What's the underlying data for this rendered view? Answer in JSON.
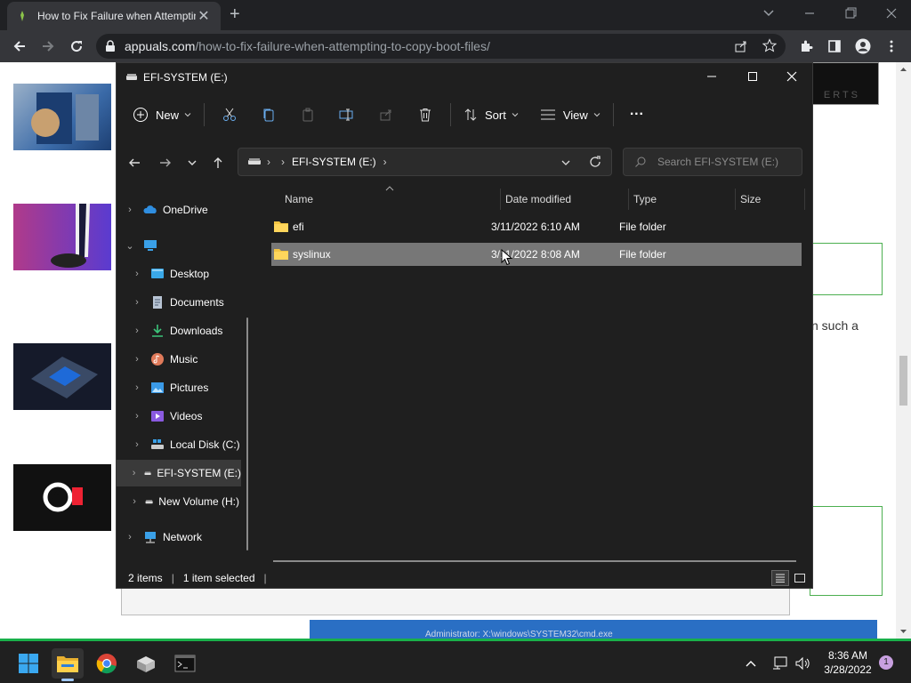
{
  "browser": {
    "tab_title": "How to Fix Failure when Attempting",
    "tab_close": "✕",
    "new_tab": "+",
    "url_domain": "appuals.com",
    "url_path": "/how-to-fix-failure-when-attempting-to-copy-boot-files/"
  },
  "page": {
    "partial_text": "n such a",
    "watermark": "ERTS",
    "bottom_window_title": "Administrator: X:\\windows\\SYSTEM32\\cmd.exe"
  },
  "explorer": {
    "title": "EFI-SYSTEM (E:)",
    "toolbar": {
      "new_label": "New",
      "sort_label": "Sort",
      "view_label": "View",
      "more": "···"
    },
    "address": {
      "location": "EFI-SYSTEM (E:)",
      "search_placeholder": "Search EFI-SYSTEM (E:)"
    },
    "nav": [
      {
        "label": "OneDrive"
      },
      {
        "label": ""
      },
      {
        "label": "Desktop"
      },
      {
        "label": "Documents"
      },
      {
        "label": "Downloads"
      },
      {
        "label": "Music"
      },
      {
        "label": "Pictures"
      },
      {
        "label": "Videos"
      },
      {
        "label": "Local Disk (C:)"
      },
      {
        "label": "EFI-SYSTEM (E:)"
      },
      {
        "label": "New Volume (H:)"
      },
      {
        "label": "Network"
      }
    ],
    "columns": {
      "name": "Name",
      "date": "Date modified",
      "type": "Type",
      "size": "Size"
    },
    "rows": [
      {
        "name": "efi",
        "date": "3/11/2022 6:10 AM",
        "type": "File folder",
        "size": ""
      },
      {
        "name": "syslinux",
        "date": "3/11/2022 8:08 AM",
        "type": "File folder",
        "size": ""
      }
    ],
    "status": {
      "items": "2 items",
      "selected": "1 item selected"
    }
  },
  "taskbar": {
    "time": "8:36 AM",
    "date": "3/28/2022",
    "notifications": "1"
  },
  "colors": {
    "accent_green": "#19b04a",
    "explorer_bg": "#1f1f1f",
    "selected_row": "#777777"
  }
}
